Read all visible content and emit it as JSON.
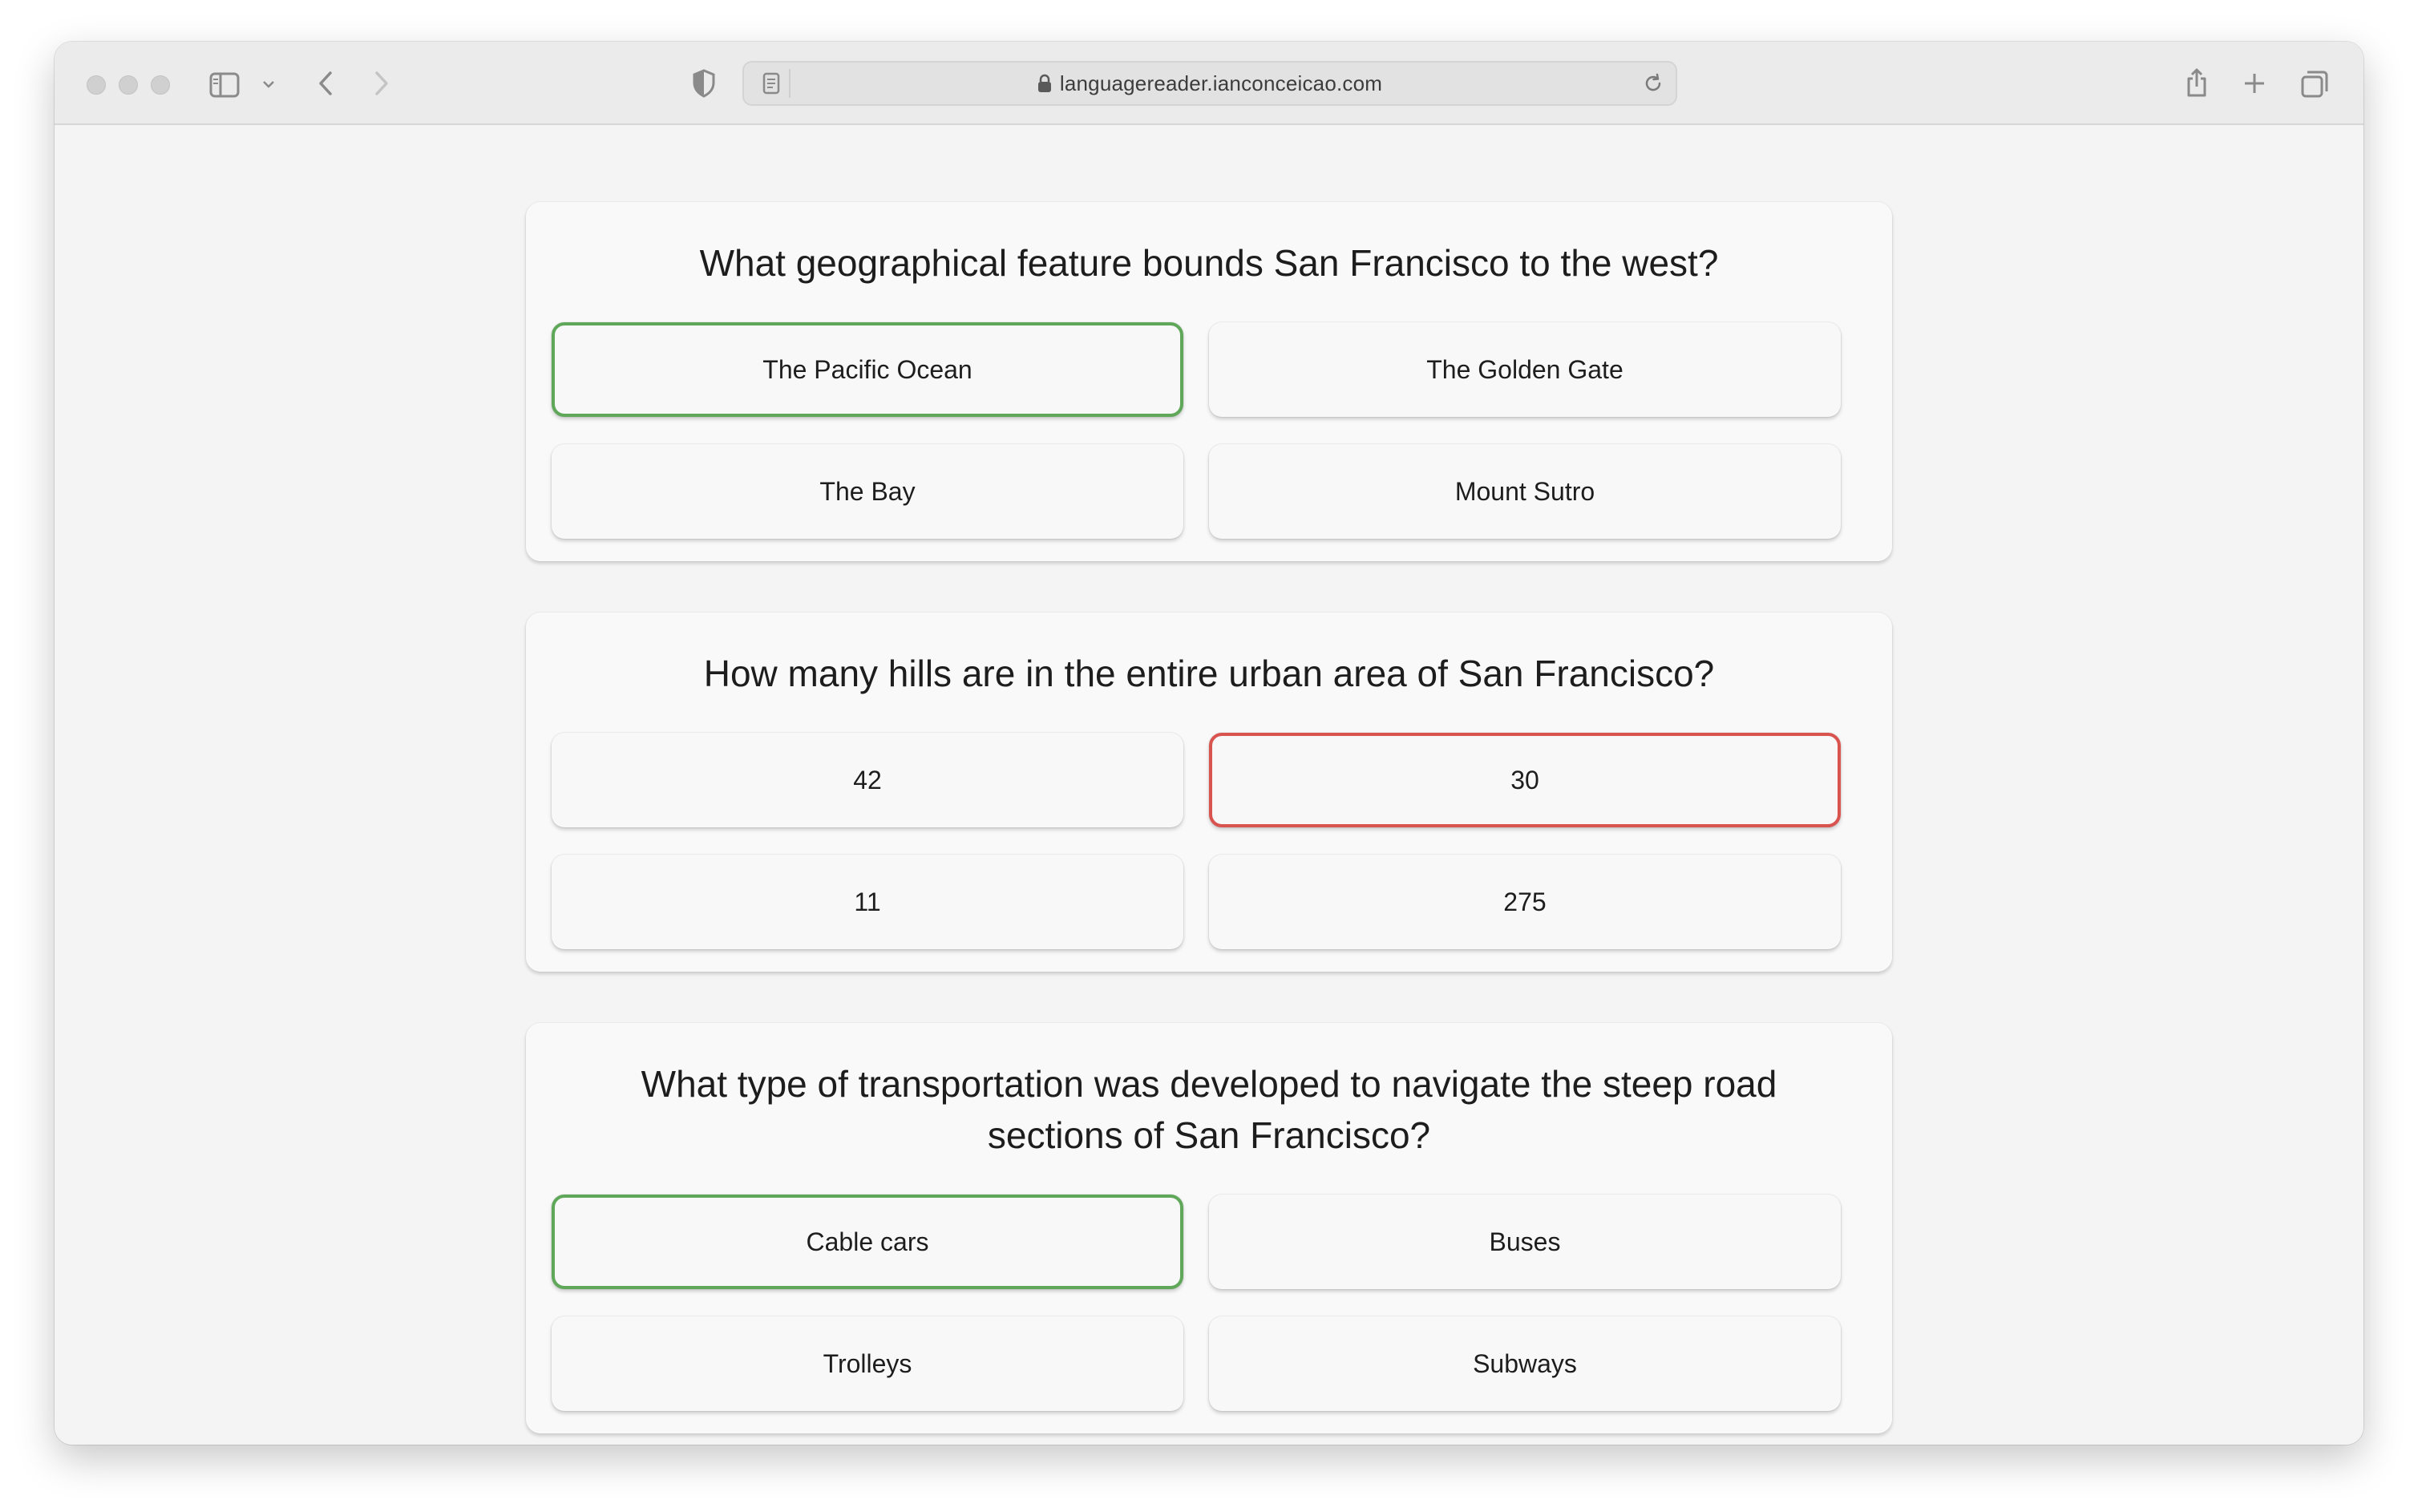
{
  "browser": {
    "url": "languagereader.ianconceicao.com"
  },
  "quiz": {
    "questions": [
      {
        "text": "What geographical feature bounds San Francisco to the west?",
        "answers": [
          "The Pacific Ocean",
          "The Golden Gate",
          "The Bay",
          "Mount Sutro"
        ],
        "answer_states": [
          "correct",
          "default",
          "default",
          "default"
        ]
      },
      {
        "text": "How many hills are in the entire urban area of San Francisco?",
        "answers": [
          "42",
          "30",
          "11",
          "275"
        ],
        "answer_states": [
          "default",
          "wrong",
          "default",
          "default"
        ]
      },
      {
        "text": "What type of transportation was developed to navigate the steep road sections of San Francisco?",
        "answers": [
          "Cable cars",
          "Buses",
          "Trolleys",
          "Subways"
        ],
        "answer_states": [
          "correct",
          "default",
          "default",
          "default"
        ]
      }
    ]
  },
  "colors": {
    "correct_border": "#5fa85a",
    "wrong_border": "#d9534f",
    "card_background": "#f9f9f9",
    "page_background": "#f4f4f4"
  }
}
